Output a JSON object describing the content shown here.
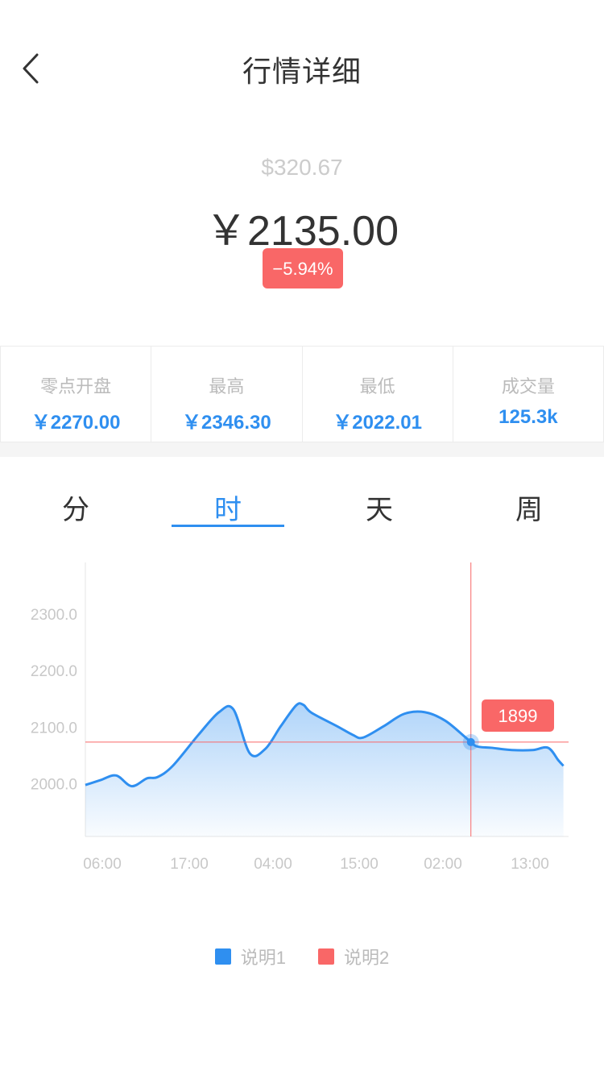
{
  "nav": {
    "title": "行情详细",
    "back_icon": "chevron-left-icon"
  },
  "price": {
    "usd": "$320.67",
    "cny": "￥2135.00",
    "change": "−5.94%"
  },
  "stats": [
    {
      "label": "零点开盘",
      "value": "￥2270.00"
    },
    {
      "label": "最高",
      "value": "￥2346.30"
    },
    {
      "label": "最低",
      "value": "￥2022.01"
    },
    {
      "label": "成交量",
      "value": "125.3k"
    }
  ],
  "tabs": [
    {
      "label": "分",
      "active": false
    },
    {
      "label": "时",
      "active": true
    },
    {
      "label": "天",
      "active": false
    },
    {
      "label": "周",
      "active": false
    }
  ],
  "colors": {
    "accent": "#2f8ff0",
    "down": "#f96767",
    "muted": "#bbbbbb"
  },
  "chart_data": {
    "type": "area",
    "x_ticks": [
      "06:00",
      "17:00",
      "04:00",
      "15:00",
      "02:00",
      "13:00"
    ],
    "y_ticks": [
      2000.0,
      2100.0,
      2200.0,
      2300.0
    ],
    "y_tick_labels": [
      "2000.0",
      "2100.0",
      "2200.0",
      "2300.0"
    ],
    "ylim": [
      1905,
      2390
    ],
    "x_range": [
      0,
      28
    ],
    "grid": false,
    "legend_position": "bottom",
    "series": [
      {
        "name": "说明1",
        "color": "#2f8ff0",
        "points": [
          [
            0.0,
            1996
          ],
          [
            1.5,
            2005
          ],
          [
            3.0,
            2013
          ],
          [
            4.5,
            1994
          ],
          [
            6.0,
            2008
          ],
          [
            7.0,
            2010
          ],
          [
            8.5,
            2030
          ],
          [
            11.0,
            2085
          ],
          [
            13.0,
            2125
          ],
          [
            14.4,
            2130
          ],
          [
            16.0,
            2052
          ],
          [
            17.5,
            2060
          ],
          [
            19.0,
            2100
          ],
          [
            20.5,
            2137
          ],
          [
            21.2,
            2138
          ],
          [
            22.0,
            2124
          ],
          [
            24.5,
            2100
          ],
          [
            26.0,
            2085
          ],
          [
            27.0,
            2080
          ],
          [
            29.0,
            2100
          ],
          [
            31.0,
            2122
          ],
          [
            33.0,
            2125
          ],
          [
            35.0,
            2110
          ],
          [
            37.0,
            2080
          ],
          [
            38.0,
            2065
          ],
          [
            39.5,
            2062
          ],
          [
            41.5,
            2058
          ],
          [
            43.5,
            2058
          ],
          [
            45.0,
            2062
          ],
          [
            46.0,
            2040
          ],
          [
            46.5,
            2030
          ]
        ]
      },
      {
        "name": "说明2",
        "color": "#f96767",
        "points": []
      }
    ],
    "crosshair": {
      "x": 37.5,
      "y": 2072,
      "label": "1899"
    }
  }
}
